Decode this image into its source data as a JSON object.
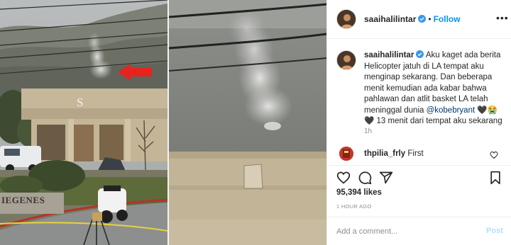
{
  "post": {
    "username": "saaihalilintar",
    "follow_label": "Follow",
    "separator": "•",
    "more_label": "•••",
    "caption": {
      "username": "saaihalilintar",
      "text_before": "Aku kaget ada berita Helicopter jatuh di LA tempat aku menginap sekarang. Dan beberapa menit kemudian ada kabar bahwa pahlawan dan atlit basket LA telah meninggal dunia ",
      "mention": "@kobebryant",
      "emoji": "🖤😭🖤",
      "text_after": " 13 menit dari tempat aku sekarang",
      "age": "1h"
    },
    "comments": [
      {
        "username": "thpilia_frly",
        "text": "First"
      }
    ],
    "likes": "95,394 likes",
    "posted": "1 HOUR AGO",
    "add_comment": {
      "placeholder": "Add a comment...",
      "post_label": "Post"
    }
  },
  "media": {
    "building_sign_letter": "S",
    "monument_sign_text": "IEGENES",
    "annotation": "red-arrow-pointing-to-smoke"
  },
  "icons": {
    "verified": "verified-badge-icon",
    "like": "heart-icon",
    "comment": "comment-bubble-icon",
    "share": "paper-plane-icon",
    "save": "bookmark-icon"
  },
  "colors": {
    "link_blue": "#0095f6",
    "mention_blue": "#00376b",
    "post_disabled": "#b2dffc",
    "arrow_red": "#e8231e",
    "muted": "#8e8e8e"
  }
}
